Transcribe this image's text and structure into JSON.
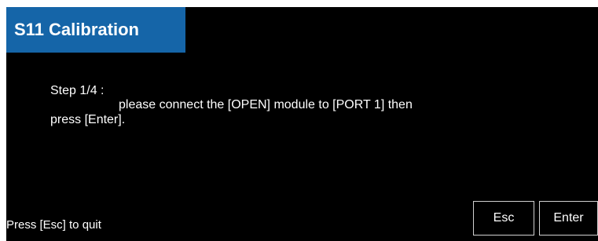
{
  "dialog": {
    "title": "S11 Calibration",
    "step_label": "Step 1/4 :",
    "instruction_line1": "please connect the [OPEN] module to [PORT 1] then",
    "instruction_line2": "press [Enter].",
    "quit_hint": "Press [Esc] to quit"
  },
  "buttons": {
    "esc_label": "Esc",
    "enter_label": "Enter"
  },
  "colors": {
    "background": "#000000",
    "title_bar": "#1565a8",
    "text": "#ffffff",
    "button_border": "#d0d0d0"
  }
}
